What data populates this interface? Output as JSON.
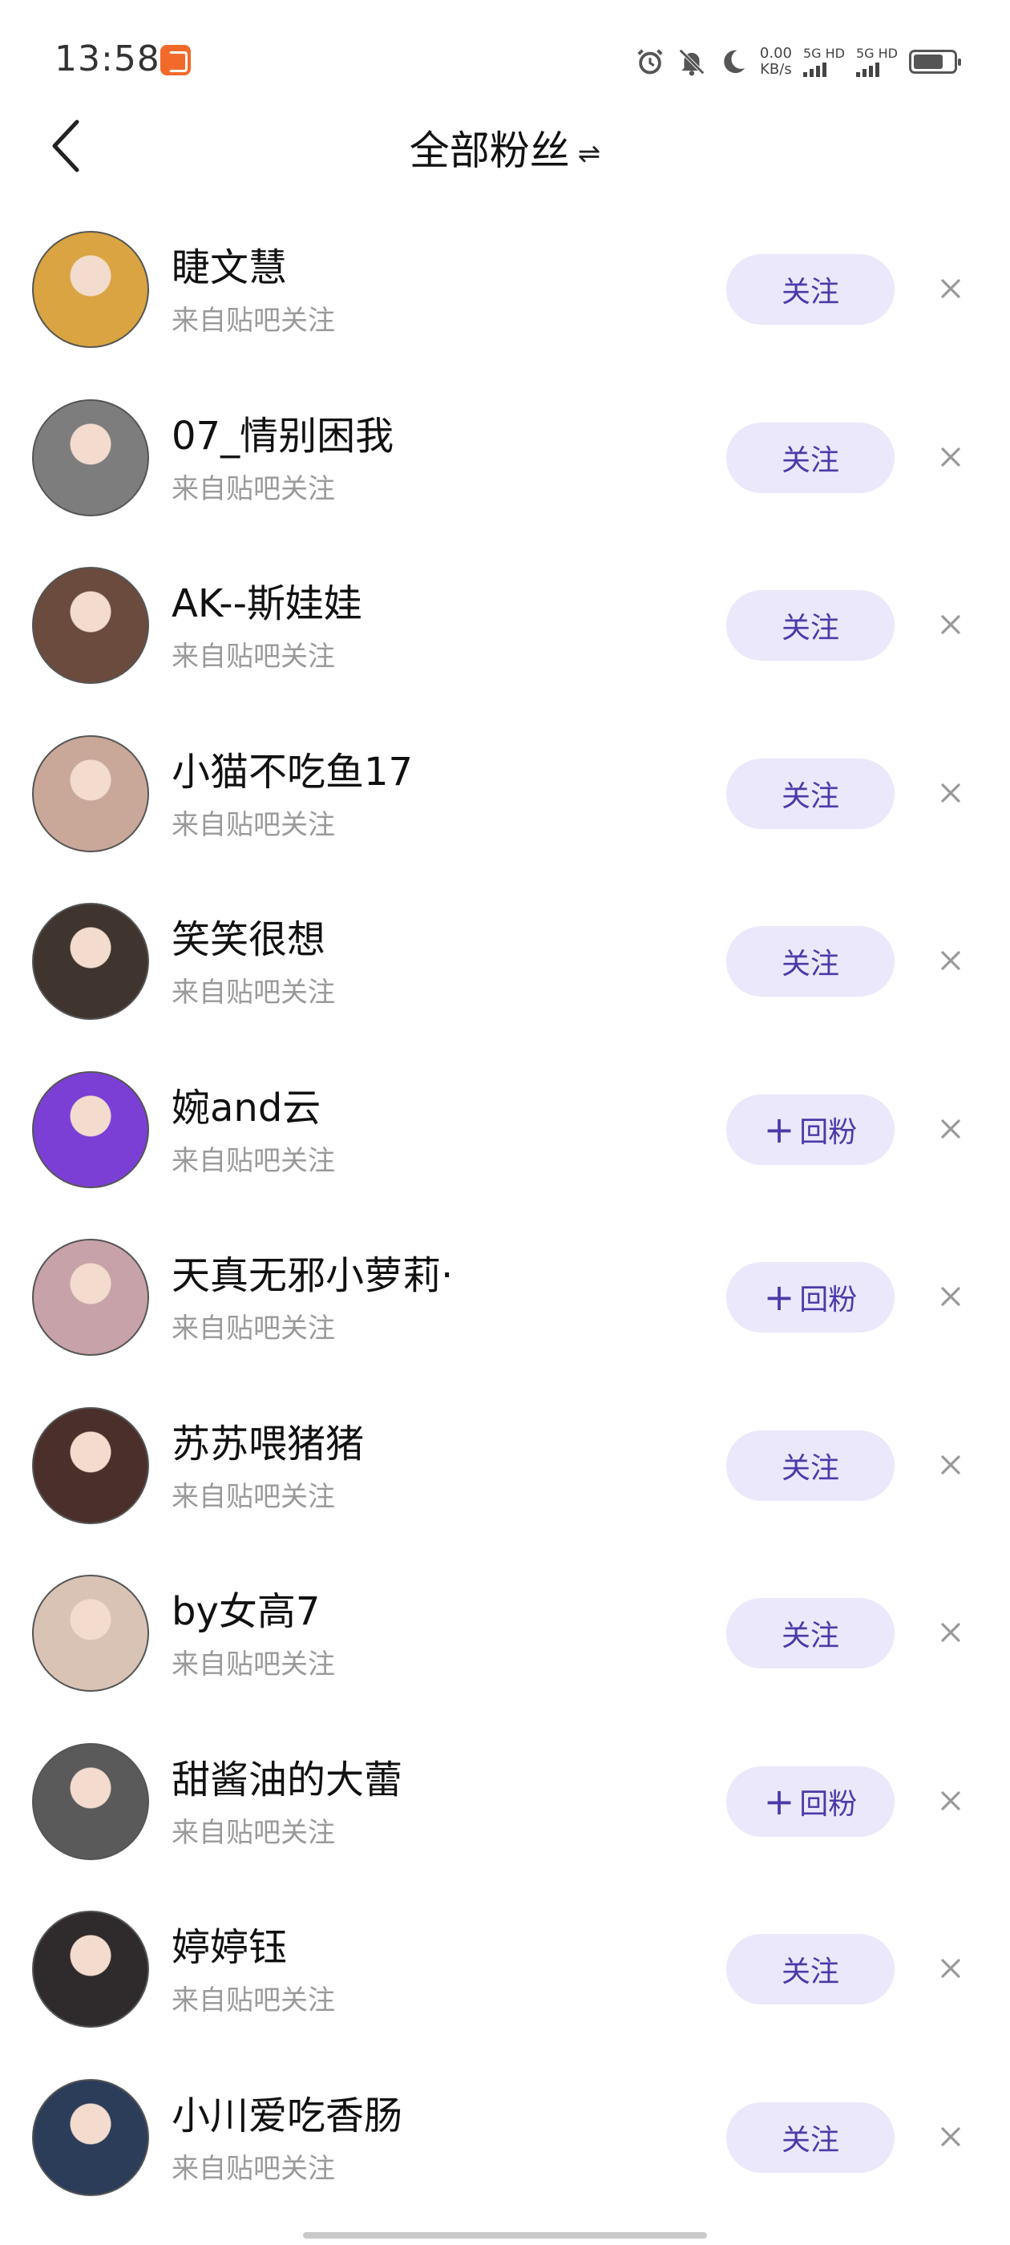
{
  "status_bar": {
    "time": "13:58",
    "net_speed_value": "0.00",
    "net_speed_unit": "KB/s",
    "sim1_label": "5G HD",
    "sim2_label": "5G HD",
    "icons": [
      "alarm-icon",
      "bell-muted-icon",
      "moon-icon",
      "battery-icon"
    ]
  },
  "header": {
    "title": "全部粉丝",
    "switch_glyph": "⇌"
  },
  "followers": [
    {
      "name": "睫文慧",
      "source": "来自贴吧关注",
      "action": "关注",
      "plus": false
    },
    {
      "name": "07_情别困我",
      "source": "来自贴吧关注",
      "action": "关注",
      "plus": false
    },
    {
      "name": "AK--斯娃娃",
      "source": "来自贴吧关注",
      "action": "关注",
      "plus": false
    },
    {
      "name": "小猫不吃鱼17",
      "source": "来自贴吧关注",
      "action": "关注",
      "plus": false
    },
    {
      "name": "笑笑很想",
      "source": "来自贴吧关注",
      "action": "关注",
      "plus": false
    },
    {
      "name": "婉and云",
      "source": "来自贴吧关注",
      "action": "回粉",
      "plus": true
    },
    {
      "name": "天真无邪小萝莉·",
      "source": "来自贴吧关注",
      "action": "回粉",
      "plus": true
    },
    {
      "name": "苏苏喂猪猪",
      "source": "来自贴吧关注",
      "action": "关注",
      "plus": false
    },
    {
      "name": "by女高7",
      "source": "来自贴吧关注",
      "action": "关注",
      "plus": false
    },
    {
      "name": "甜酱油的大蕾",
      "source": "来自贴吧关注",
      "action": "回粉",
      "plus": true
    },
    {
      "name": "婷婷钰",
      "source": "来自贴吧关注",
      "action": "关注",
      "plus": false
    },
    {
      "name": "小川爱吃香肠",
      "source": "来自贴吧关注",
      "action": "关注",
      "plus": false
    }
  ],
  "colors": {
    "button_bg": "#ece8fb",
    "button_text": "#4c3aa8",
    "secondary_text": "#9a9a9a",
    "avatar_palette": [
      "#d9a441",
      "#7d7d7d",
      "#6b4b3d",
      "#c9a89a",
      "#3f342e",
      "#7b3fd6",
      "#c7a2a8",
      "#4a2f2b",
      "#d8c3b5",
      "#5a5a5a",
      "#2f2a2c",
      "#2c3d5a"
    ]
  }
}
